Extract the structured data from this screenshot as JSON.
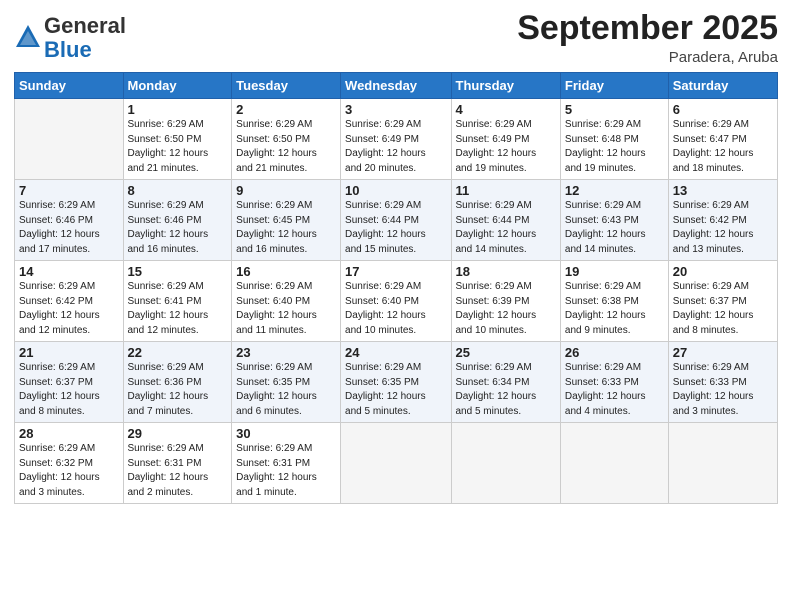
{
  "logo": {
    "general": "General",
    "blue": "Blue"
  },
  "title": "September 2025",
  "location": "Paradera, Aruba",
  "weekdays": [
    "Sunday",
    "Monday",
    "Tuesday",
    "Wednesday",
    "Thursday",
    "Friday",
    "Saturday"
  ],
  "weeks": [
    [
      {
        "day": "",
        "info": ""
      },
      {
        "day": "1",
        "info": "Sunrise: 6:29 AM\nSunset: 6:50 PM\nDaylight: 12 hours\nand 21 minutes."
      },
      {
        "day": "2",
        "info": "Sunrise: 6:29 AM\nSunset: 6:50 PM\nDaylight: 12 hours\nand 21 minutes."
      },
      {
        "day": "3",
        "info": "Sunrise: 6:29 AM\nSunset: 6:49 PM\nDaylight: 12 hours\nand 20 minutes."
      },
      {
        "day": "4",
        "info": "Sunrise: 6:29 AM\nSunset: 6:49 PM\nDaylight: 12 hours\nand 19 minutes."
      },
      {
        "day": "5",
        "info": "Sunrise: 6:29 AM\nSunset: 6:48 PM\nDaylight: 12 hours\nand 19 minutes."
      },
      {
        "day": "6",
        "info": "Sunrise: 6:29 AM\nSunset: 6:47 PM\nDaylight: 12 hours\nand 18 minutes."
      }
    ],
    [
      {
        "day": "7",
        "info": "Sunrise: 6:29 AM\nSunset: 6:46 PM\nDaylight: 12 hours\nand 17 minutes."
      },
      {
        "day": "8",
        "info": "Sunrise: 6:29 AM\nSunset: 6:46 PM\nDaylight: 12 hours\nand 16 minutes."
      },
      {
        "day": "9",
        "info": "Sunrise: 6:29 AM\nSunset: 6:45 PM\nDaylight: 12 hours\nand 16 minutes."
      },
      {
        "day": "10",
        "info": "Sunrise: 6:29 AM\nSunset: 6:44 PM\nDaylight: 12 hours\nand 15 minutes."
      },
      {
        "day": "11",
        "info": "Sunrise: 6:29 AM\nSunset: 6:44 PM\nDaylight: 12 hours\nand 14 minutes."
      },
      {
        "day": "12",
        "info": "Sunrise: 6:29 AM\nSunset: 6:43 PM\nDaylight: 12 hours\nand 14 minutes."
      },
      {
        "day": "13",
        "info": "Sunrise: 6:29 AM\nSunset: 6:42 PM\nDaylight: 12 hours\nand 13 minutes."
      }
    ],
    [
      {
        "day": "14",
        "info": "Sunrise: 6:29 AM\nSunset: 6:42 PM\nDaylight: 12 hours\nand 12 minutes."
      },
      {
        "day": "15",
        "info": "Sunrise: 6:29 AM\nSunset: 6:41 PM\nDaylight: 12 hours\nand 12 minutes."
      },
      {
        "day": "16",
        "info": "Sunrise: 6:29 AM\nSunset: 6:40 PM\nDaylight: 12 hours\nand 11 minutes."
      },
      {
        "day": "17",
        "info": "Sunrise: 6:29 AM\nSunset: 6:40 PM\nDaylight: 12 hours\nand 10 minutes."
      },
      {
        "day": "18",
        "info": "Sunrise: 6:29 AM\nSunset: 6:39 PM\nDaylight: 12 hours\nand 10 minutes."
      },
      {
        "day": "19",
        "info": "Sunrise: 6:29 AM\nSunset: 6:38 PM\nDaylight: 12 hours\nand 9 minutes."
      },
      {
        "day": "20",
        "info": "Sunrise: 6:29 AM\nSunset: 6:37 PM\nDaylight: 12 hours\nand 8 minutes."
      }
    ],
    [
      {
        "day": "21",
        "info": "Sunrise: 6:29 AM\nSunset: 6:37 PM\nDaylight: 12 hours\nand 8 minutes."
      },
      {
        "day": "22",
        "info": "Sunrise: 6:29 AM\nSunset: 6:36 PM\nDaylight: 12 hours\nand 7 minutes."
      },
      {
        "day": "23",
        "info": "Sunrise: 6:29 AM\nSunset: 6:35 PM\nDaylight: 12 hours\nand 6 minutes."
      },
      {
        "day": "24",
        "info": "Sunrise: 6:29 AM\nSunset: 6:35 PM\nDaylight: 12 hours\nand 5 minutes."
      },
      {
        "day": "25",
        "info": "Sunrise: 6:29 AM\nSunset: 6:34 PM\nDaylight: 12 hours\nand 5 minutes."
      },
      {
        "day": "26",
        "info": "Sunrise: 6:29 AM\nSunset: 6:33 PM\nDaylight: 12 hours\nand 4 minutes."
      },
      {
        "day": "27",
        "info": "Sunrise: 6:29 AM\nSunset: 6:33 PM\nDaylight: 12 hours\nand 3 minutes."
      }
    ],
    [
      {
        "day": "28",
        "info": "Sunrise: 6:29 AM\nSunset: 6:32 PM\nDaylight: 12 hours\nand 3 minutes."
      },
      {
        "day": "29",
        "info": "Sunrise: 6:29 AM\nSunset: 6:31 PM\nDaylight: 12 hours\nand 2 minutes."
      },
      {
        "day": "30",
        "info": "Sunrise: 6:29 AM\nSunset: 6:31 PM\nDaylight: 12 hours\nand 1 minute."
      },
      {
        "day": "",
        "info": ""
      },
      {
        "day": "",
        "info": ""
      },
      {
        "day": "",
        "info": ""
      },
      {
        "day": "",
        "info": ""
      }
    ]
  ]
}
